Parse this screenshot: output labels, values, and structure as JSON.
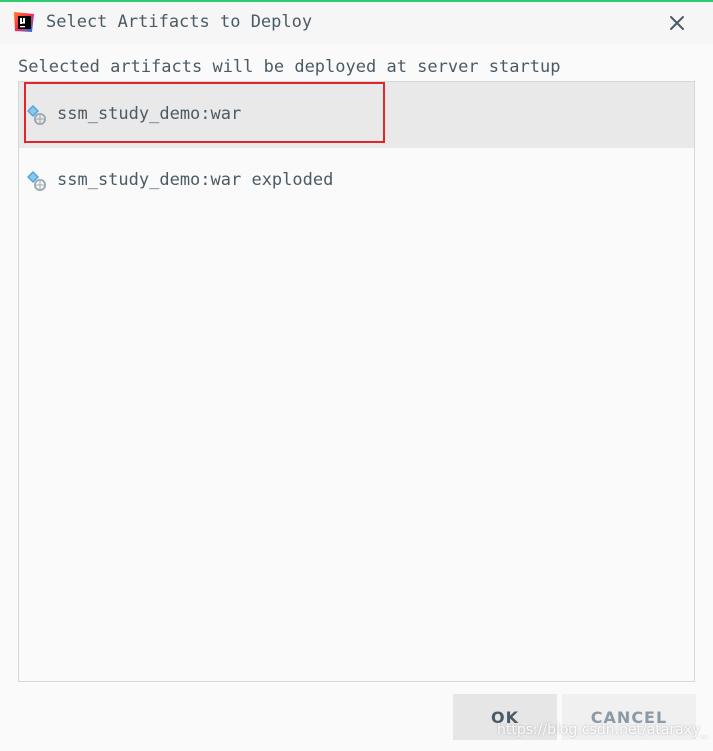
{
  "dialog": {
    "title": "Select Artifacts to Deploy",
    "app_icon": "intellij-idea-icon",
    "close_icon": "close-icon"
  },
  "subtitle": "Selected artifacts will be deployed at server startup",
  "artifacts": [
    {
      "label": "ssm_study_demo:war",
      "icon": "web-artifact-icon",
      "selected": true,
      "highlighted": true
    },
    {
      "label": "ssm_study_demo:war exploded",
      "icon": "web-artifact-icon",
      "selected": false,
      "highlighted": false
    }
  ],
  "buttons": {
    "ok_label": "OK",
    "cancel_label": "CANCEL"
  },
  "watermark": "https://blog.csdn.net/ataraxy_",
  "colors": {
    "accent_top": "#2ecc71",
    "highlight": "#e0262b",
    "selected_row": "#e9e9e9",
    "text": "#4b5b66"
  }
}
